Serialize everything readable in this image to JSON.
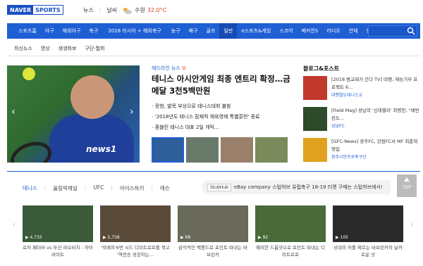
{
  "brand": {
    "naver": "NAVER",
    "sports": "SPORTS"
  },
  "top_links": [
    "뉴스",
    "날씨"
  ],
  "weather": {
    "location": "수원",
    "temp": "32.0°C"
  },
  "nav": {
    "items": [
      "스포츠홈",
      "야구",
      "해외야구",
      "축구",
      "2018 러시아 + 해외축구",
      "농구",
      "배구",
      "골프",
      "일반",
      "e스포츠&게임",
      "스코어",
      "베커진S",
      "라디오",
      "연재",
      "랭킹"
    ],
    "active": "일반"
  },
  "subnav": [
    "최신뉴스",
    "영상",
    "생생화보",
    "구단·협회"
  ],
  "headline": {
    "source": "헤드라인 뉴스",
    "title": "테니스 아시안게임 최종 엔트리 확정…금메달 3천5백만원",
    "bullets": [
      "정현, 발목 부상으로 테니스대회 불참",
      "'2018년도 테니스 잠재적 체육영재 특별훈련' 종료",
      "콤블린 테니스 대표 2일 개막…"
    ]
  },
  "side": {
    "title": "블로그&포스트",
    "items": [
      {
        "text": "[2018 범교래가 간다 TV] 대행, 재능기부 프로젝트 6...",
        "src": "대행철도테니스교"
      },
      {
        "text": "[Field Mag] 성남의 '신데렐라' 최병찬, \"매번전도...",
        "src": "성남FC"
      },
      {
        "text": "[GFC-News] 광주FC, 강원FC서 MF 최준혁 영입",
        "src": "광주시민프로축구단"
      }
    ]
  },
  "tabs": [
    "테니스",
    "올림픽채널",
    "UFC",
    "아이스하키",
    "레슨"
  ],
  "promo": {
    "badge": "StubHub",
    "text": "eBay company 스텁허브 유럽축구 18-19 티켓 구매는 스텁허브에서!"
  },
  "top_button": "TOP",
  "videos": [
    {
      "caption": "로저 페더러 vs 두산 라오비치 - 하이라이트",
      "count": "4,733"
    },
    {
      "caption": "'빅매치'6번 시드 디미트로프를 꺾고 '역전승 성공하는...",
      "count": "5,758"
    },
    {
      "caption": "감각적인 백핸드로 포인트 따내는 바브린카",
      "count": "68"
    },
    {
      "caption": "예리한 드롭샷으로 포인트 따내는 디미트로프",
      "count": "92"
    },
    {
      "caption": "상대의 허를 찌르는 바브린카의 날카로운 샷",
      "count": "105"
    }
  ]
}
